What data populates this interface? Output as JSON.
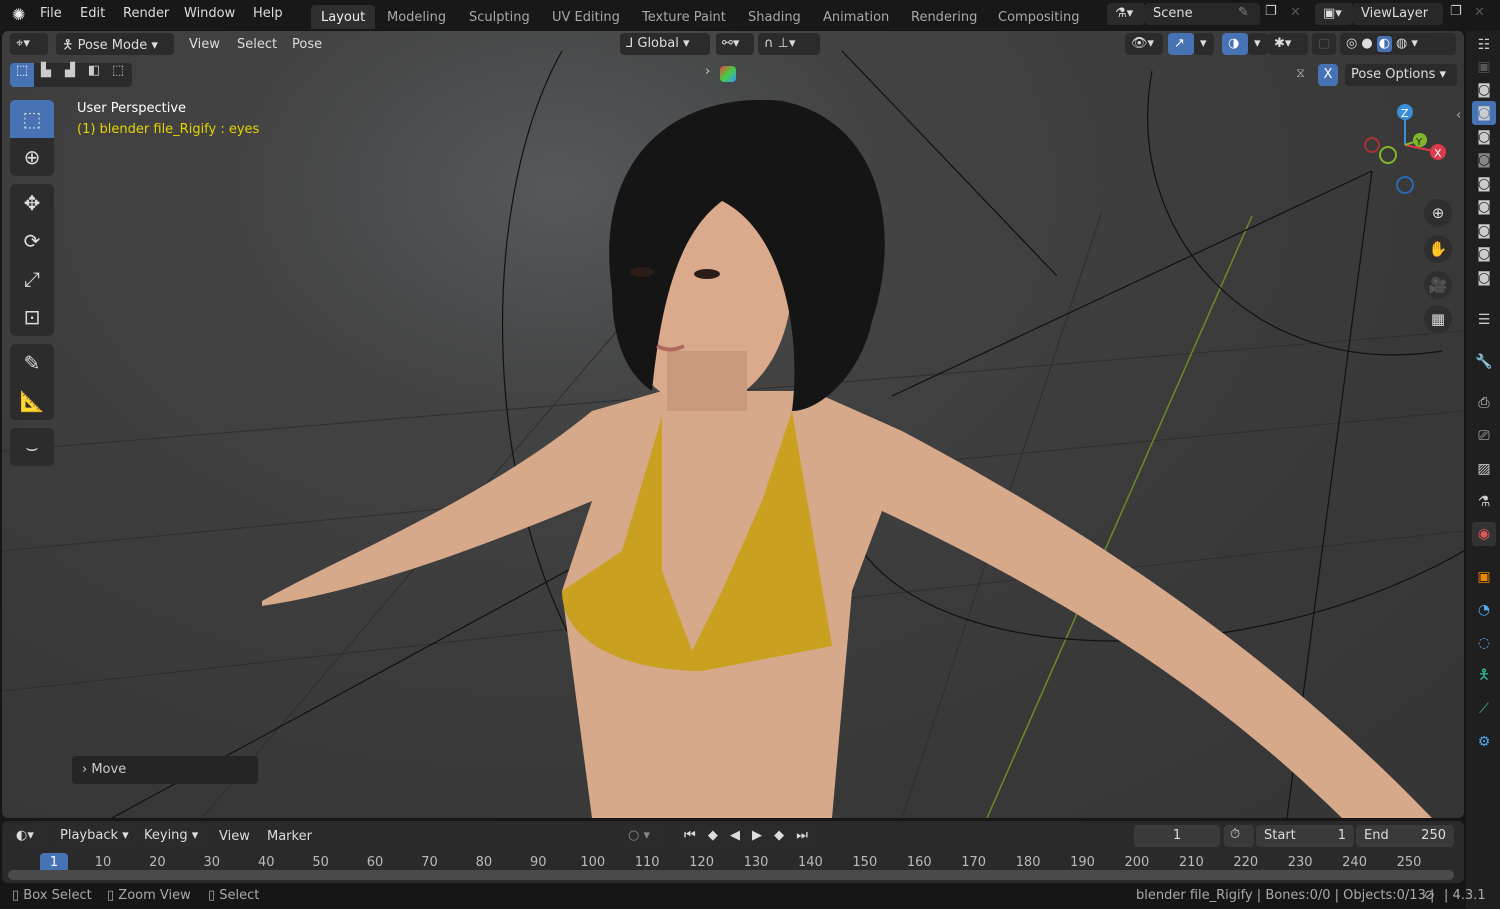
{
  "topbar": {
    "menus": [
      "File",
      "Edit",
      "Render",
      "Window",
      "Help"
    ],
    "workspaces": [
      "Layout",
      "Modeling",
      "Sculpting",
      "UV Editing",
      "Texture Paint",
      "Shading",
      "Animation",
      "Rendering",
      "Compositing"
    ],
    "active_workspace": "Layout",
    "scene": "Scene",
    "view_layer": "ViewLayer"
  },
  "viewport_header": {
    "mode": "Pose Mode",
    "menus": [
      "View",
      "Select",
      "Pose"
    ],
    "orientation": "Global",
    "pose_options": "Pose Options",
    "x_mirror": "X"
  },
  "viewport": {
    "view_name": "User Perspective",
    "object_info": "(1) blender file_Rigify : eyes",
    "operator_panel": "Move",
    "gizmo_axes": {
      "x": "X",
      "y": "Y",
      "z": "Z"
    },
    "accent": "#4772b3",
    "info_color": "#e6d300"
  },
  "toolbar": {
    "tools": [
      "select-box",
      "cursor",
      "move",
      "rotate",
      "scale",
      "transform",
      "annotate",
      "measure",
      "relax"
    ],
    "active": "select-box"
  },
  "timeline": {
    "menus": [
      "Playback",
      "Keying",
      "View",
      "Marker"
    ],
    "current_frame": "1",
    "start_label": "Start",
    "start": "1",
    "end_label": "End",
    "end": "250",
    "ticks": [
      "1",
      "10",
      "20",
      "30",
      "40",
      "50",
      "60",
      "70",
      "80",
      "90",
      "100",
      "110",
      "120",
      "130",
      "140",
      "150",
      "160",
      "170",
      "180",
      "190",
      "200",
      "210",
      "220",
      "230",
      "240",
      "250"
    ]
  },
  "statusbar": {
    "hints": [
      "Box Select",
      "Zoom View",
      "Select"
    ],
    "info": "blender file_Rigify | Bones:0/0 | Objects:0/13 |",
    "version": "| 4.3.1"
  }
}
